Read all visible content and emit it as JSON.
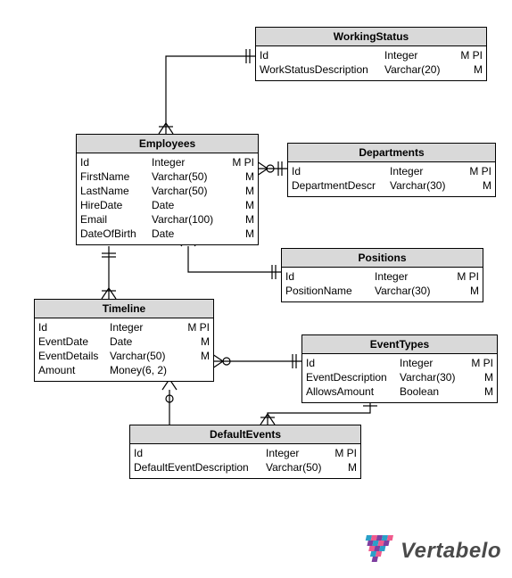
{
  "entities": {
    "workingStatus": {
      "title": "WorkingStatus",
      "rows": [
        {
          "name": "Id",
          "type": "Integer",
          "flags": "M PI"
        },
        {
          "name": "WorkStatusDescription",
          "type": "Varchar(20)",
          "flags": "M"
        }
      ]
    },
    "employees": {
      "title": "Employees",
      "rows": [
        {
          "name": "Id",
          "type": "Integer",
          "flags": "M PI"
        },
        {
          "name": "FirstName",
          "type": "Varchar(50)",
          "flags": "M"
        },
        {
          "name": "LastName",
          "type": "Varchar(50)",
          "flags": "M"
        },
        {
          "name": "HireDate",
          "type": "Date",
          "flags": "M"
        },
        {
          "name": "Email",
          "type": "Varchar(100)",
          "flags": "M"
        },
        {
          "name": "DateOfBirth",
          "type": "Date",
          "flags": "M"
        }
      ]
    },
    "departments": {
      "title": "Departments",
      "rows": [
        {
          "name": "Id",
          "type": "Integer",
          "flags": "M PI"
        },
        {
          "name": "DepartmentDescr",
          "type": "Varchar(30)",
          "flags": "M"
        }
      ]
    },
    "positions": {
      "title": "Positions",
      "rows": [
        {
          "name": "Id",
          "type": "Integer",
          "flags": "M PI"
        },
        {
          "name": "PositionName",
          "type": "Varchar(30)",
          "flags": "M"
        }
      ]
    },
    "timeline": {
      "title": "Timeline",
      "rows": [
        {
          "name": "Id",
          "type": "Integer",
          "flags": "M PI"
        },
        {
          "name": "EventDate",
          "type": "Date",
          "flags": "M"
        },
        {
          "name": "EventDetails",
          "type": "Varchar(50)",
          "flags": "M"
        },
        {
          "name": "Amount",
          "type": "Money(6, 2)",
          "flags": ""
        }
      ]
    },
    "eventTypes": {
      "title": "EventTypes",
      "rows": [
        {
          "name": "Id",
          "type": "Integer",
          "flags": "M PI"
        },
        {
          "name": "EventDescription",
          "type": "Varchar(30)",
          "flags": "M"
        },
        {
          "name": "AllowsAmount",
          "type": "Boolean",
          "flags": "M"
        }
      ]
    },
    "defaultEvents": {
      "title": "DefaultEvents",
      "rows": [
        {
          "name": "Id",
          "type": "Integer",
          "flags": "M PI"
        },
        {
          "name": "DefaultEventDescription",
          "type": "Varchar(50)",
          "flags": "M"
        }
      ]
    }
  },
  "logo": {
    "text": "Vertabelo"
  }
}
